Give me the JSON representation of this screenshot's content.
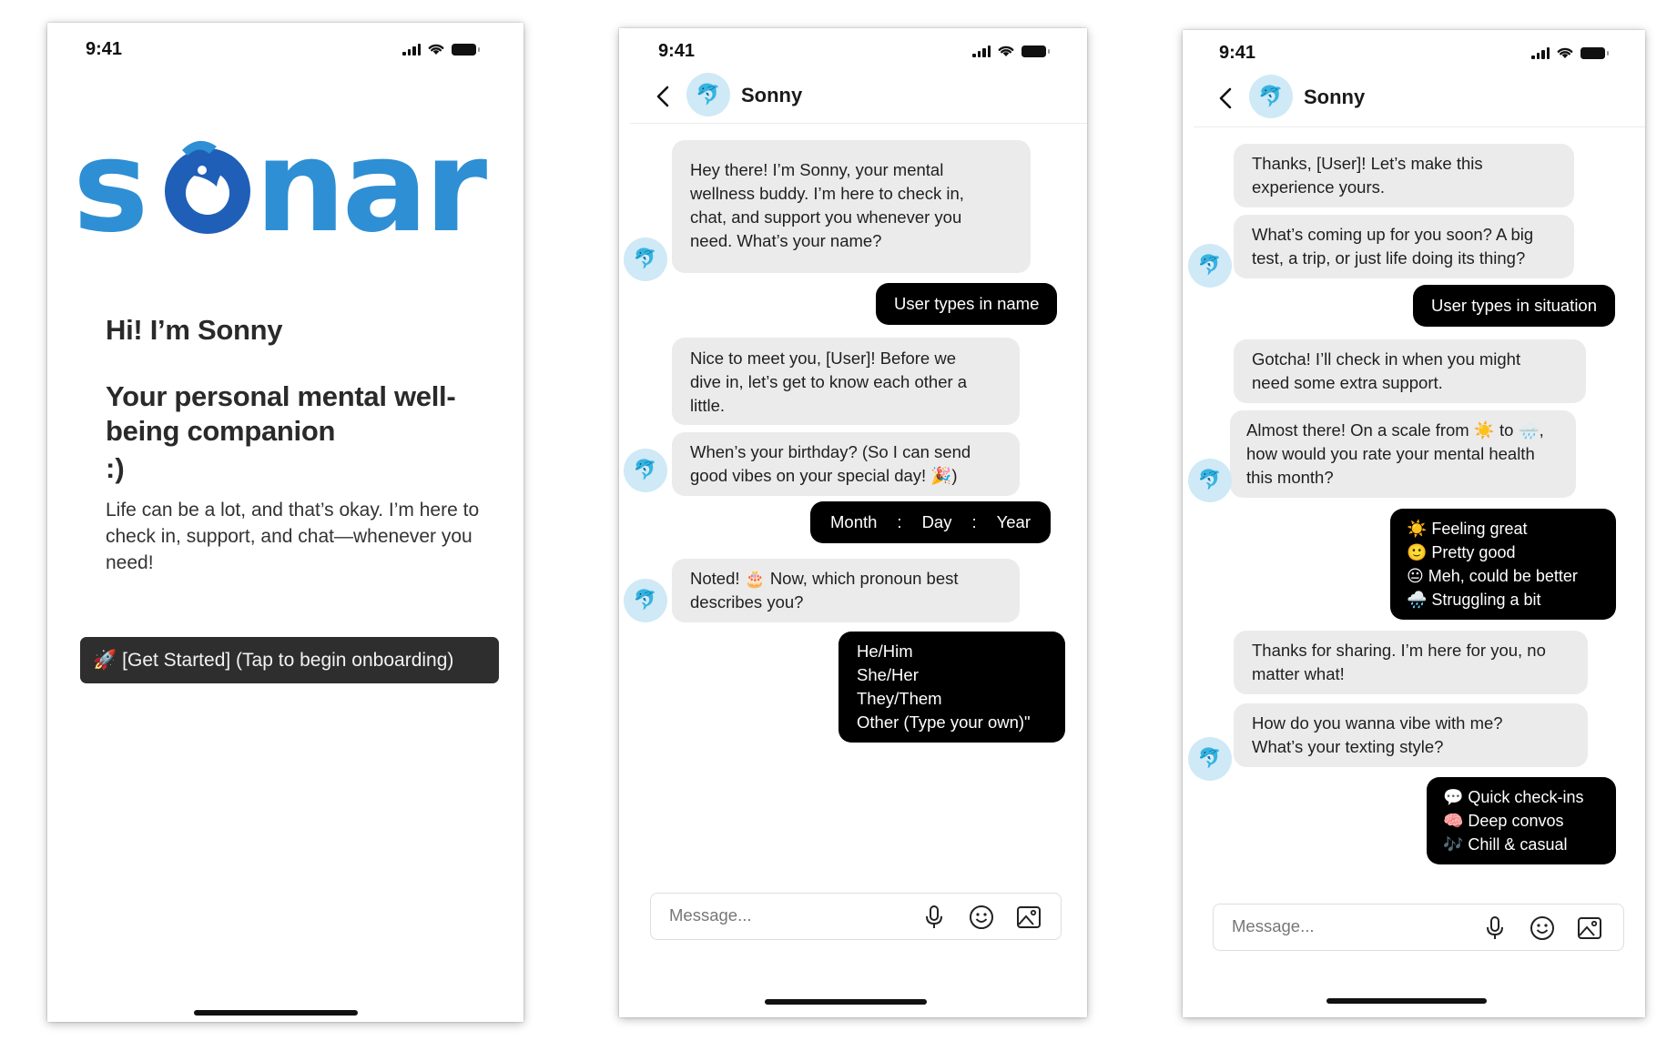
{
  "screens": {
    "welcome": {
      "status_time": "9:41",
      "logo_text": "sonar",
      "greeting": "Hi! I’m Sonny",
      "tagline": "Your personal mental well-being companion",
      "smiley": ":)",
      "intro": "Life can be a lot, and that’s okay. I’m here to check in, support, and chat—whenever you need!",
      "cta_icon": "🚀",
      "cta_label": "[Get Started] (Tap to begin onboarding)"
    },
    "chat_one": {
      "status_time": "9:41",
      "contact_name": "Sonny",
      "avatar_icon": "🐬",
      "bot_intro": [
        "Hey there! I’m Sonny, your mental",
        "wellness buddy. I’m here to check in,",
        "chat, and support you whenever you",
        "need. What’s your name?"
      ],
      "user_name_reply": "User types in name",
      "bot_nice": [
        "Nice to meet you, [User]! Before we",
        "dive in, let’s get to know each other a",
        "little."
      ],
      "bot_birthday": [
        "When’s your birthday? (So I can send",
        "good vibes on your special day! 🎉)"
      ],
      "dob_month": "Month",
      "dob_sep": ":",
      "dob_day": "Day",
      "dob_year": "Year",
      "bot_pronoun": [
        "Noted! 🎂 Now, which pronoun best",
        "describes you?"
      ],
      "pronoun_options": [
        "He/Him",
        "She/Her",
        "They/Them",
        "Other (Type your own)\""
      ],
      "message_placeholder": "Message..."
    },
    "chat_two": {
      "status_time": "9:41",
      "contact_name": "Sonny",
      "avatar_icon": "🐬",
      "bot_thanks": [
        "Thanks, [User]! Let’s make this",
        "experience yours."
      ],
      "bot_upcoming": [
        "What’s coming up for you soon? A big",
        "test, a trip, or just life doing its thing?"
      ],
      "user_situation_reply": "User types in situation",
      "bot_gotcha": [
        "Gotcha! I’ll check in when you might",
        "need some extra support."
      ],
      "bot_scale": [
        "Almost there! On a scale from ☀️ to 🌧️,",
        "how would you rate your mental health",
        "this month?"
      ],
      "mood_options": [
        "☀️ Feeling great",
        "🙂 Pretty good",
        "😐 Meh, could be better",
        "🌧️ Struggling a bit"
      ],
      "bot_sharing": [
        "Thanks for sharing. I’m here for you, no",
        "matter what!"
      ],
      "bot_vibe": [
        "How do you wanna vibe with me?",
        "What’s your texting style?"
      ],
      "style_options": [
        "💬 Quick check-ins",
        "🧠 Deep convos",
        "🎶 Chill & casual"
      ],
      "message_placeholder": "Message..."
    }
  },
  "colors": {
    "logo_blue": "#2e8fd4",
    "logo_dark_blue": "#1f5fb8",
    "bot_bubble": "#ebebeb",
    "user_bubble": "#000000",
    "avatar_bg": "#cfe9f6",
    "cta_bg": "#2e2e2e"
  },
  "icons": [
    "signal-icon",
    "wifi-icon",
    "battery-icon",
    "back-chevron-icon",
    "dolphin-avatar-icon",
    "microphone-icon",
    "emoji-icon",
    "image-icon"
  ]
}
